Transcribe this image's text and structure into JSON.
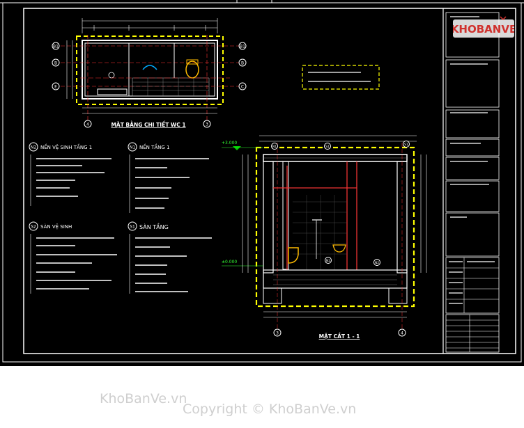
{
  "sheet": {
    "plan_title": "MẶT BẰNG CHI TIẾT WC 1",
    "section_title": "MẶT CẮT 1 - 1",
    "notes": [
      {
        "code": "N2",
        "title": "NỀN VỆ SINH TẦNG 1"
      },
      {
        "code": "N1",
        "title": "NỀN TẦNG 1"
      },
      {
        "code": "S2",
        "title": "SÀN VỆ SINH"
      },
      {
        "code": "S1",
        "title": "SÀN TẦNG"
      }
    ],
    "grid_labels": {
      "plan_rows": [
        "B1",
        "B",
        "E",
        "C"
      ],
      "plan_cols": [
        "4",
        "3"
      ],
      "section_cols": [
        "3",
        "4"
      ],
      "section_marks": [
        "N1",
        "S1",
        "N2",
        "N2",
        "S1"
      ]
    },
    "levels": [
      "+3.000",
      "±0.000"
    ]
  },
  "title_block": {
    "rows": [
      "",
      "",
      "",
      "",
      "",
      "",
      "",
      "",
      "",
      "",
      "",
      "",
      "",
      ""
    ]
  },
  "watermark": {
    "brand": "KHOBANVE",
    "site1": "KhoBanVe.vn",
    "site2": "Copyright © KhoBanVe.vn"
  },
  "colors": {
    "background": "#000000",
    "frame": "#ffffff",
    "dashed": "#ffff00",
    "wall": "#ffffff",
    "brand_red": "#d0312d"
  }
}
